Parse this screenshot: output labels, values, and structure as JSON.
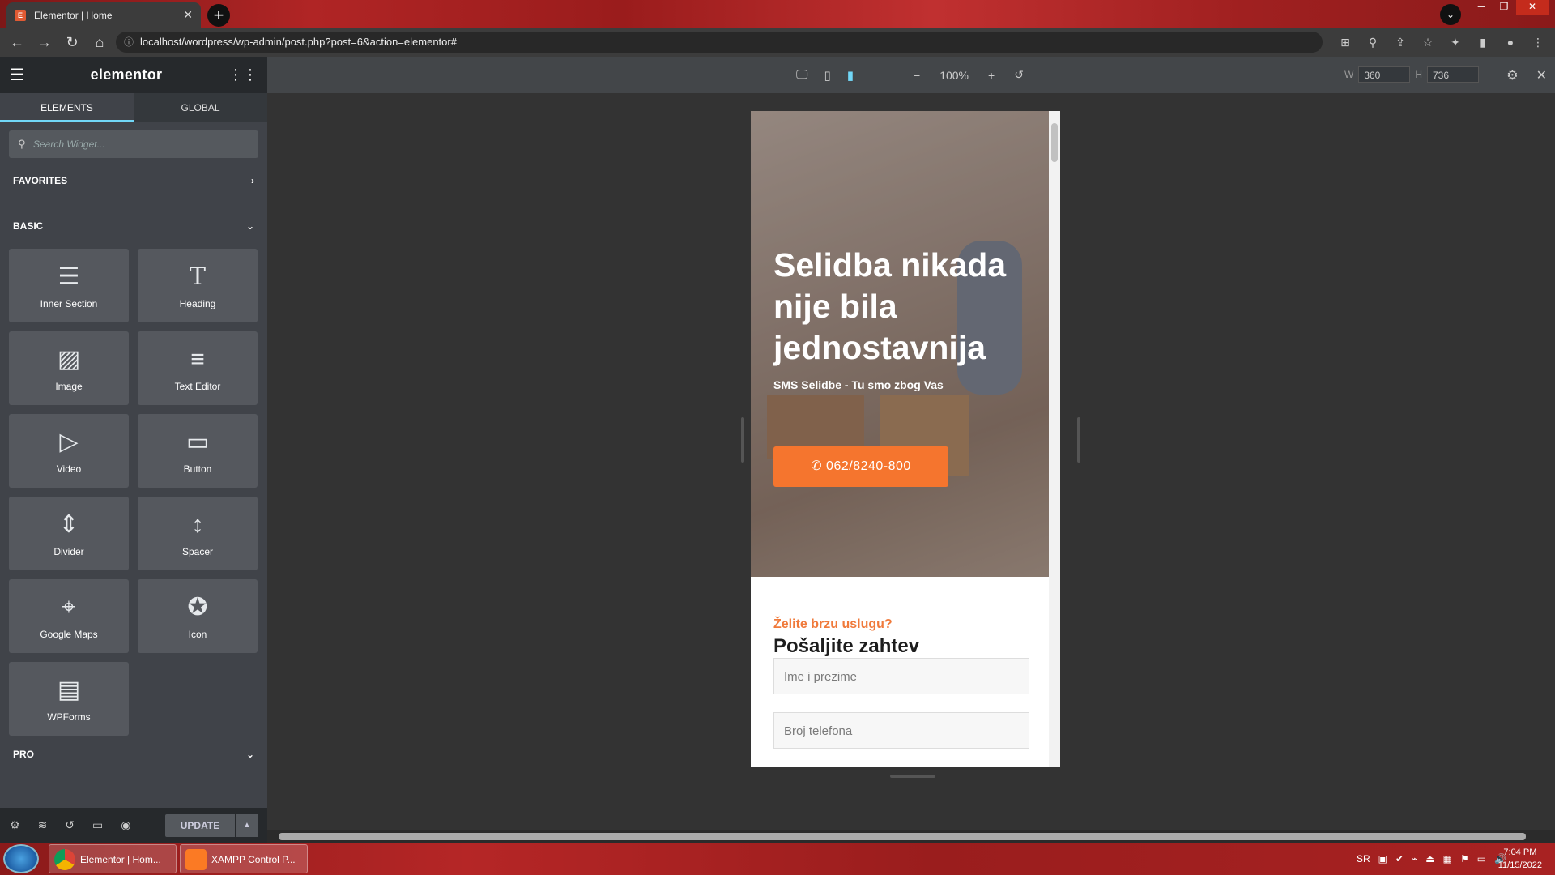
{
  "browser": {
    "tab_title": "Elementor | Home",
    "tab_favicon": "E",
    "url": "localhost/wordpress/wp-admin/post.php?post=6&action=elementor#"
  },
  "panel": {
    "logo": "elementor",
    "tabs": [
      "ELEMENTS",
      "GLOBAL"
    ],
    "search_placeholder": "Search Widget...",
    "categories": {
      "favorites": "FAVORITES",
      "basic": "BASIC",
      "pro": "PRO"
    },
    "widgets": [
      {
        "label": "Inner Section",
        "icon": "inner-section-icon"
      },
      {
        "label": "Heading",
        "icon": "heading-icon"
      },
      {
        "label": "Image",
        "icon": "image-icon"
      },
      {
        "label": "Text Editor",
        "icon": "text-editor-icon"
      },
      {
        "label": "Video",
        "icon": "video-icon"
      },
      {
        "label": "Button",
        "icon": "button-icon"
      },
      {
        "label": "Divider",
        "icon": "divider-icon"
      },
      {
        "label": "Spacer",
        "icon": "spacer-icon"
      },
      {
        "label": "Google Maps",
        "icon": "google-maps-icon"
      },
      {
        "label": "Icon",
        "icon": "icon-widget-icon"
      },
      {
        "label": "WPForms",
        "icon": "wpforms-icon"
      }
    ],
    "update_label": "UPDATE"
  },
  "preview_toolbar": {
    "zoom": "100%",
    "width_label": "W",
    "width": "360",
    "height_label": "H",
    "height": "736"
  },
  "site": {
    "hero_heading": "Selidba nikada nije bila jednostavnija",
    "hero_subtitle": "SMS Selidbe - Tu smo zbog Vas",
    "cta_phone": "062/8240-800",
    "form_kicker": "Želite brzu uslugu?",
    "form_title": "Pošaljite zahtev",
    "field_name_placeholder": "Ime i prezime",
    "field_phone_placeholder": "Broj telefona"
  },
  "taskbar": {
    "tasks": [
      "Elementor | Hom...",
      "XAMPP Control P..."
    ],
    "lang": "SR",
    "time": "7:04 PM",
    "date": "11/15/2022"
  },
  "colors": {
    "accent": "#71d7f7",
    "cta": "#f5752e",
    "kicker": "#f07a3b"
  }
}
